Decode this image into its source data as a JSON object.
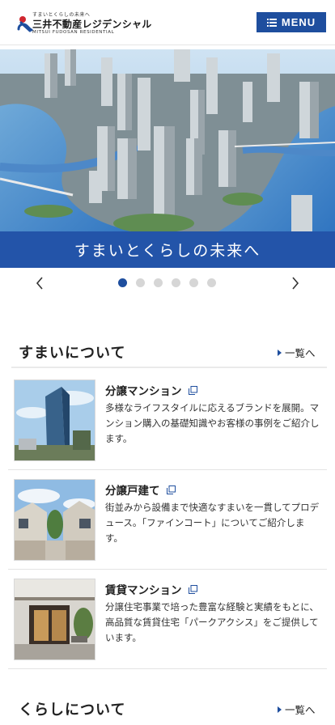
{
  "header": {
    "logo_tagline": "すまいとくらしの未来へ",
    "logo_name": "三井不動産レジデンシャル",
    "logo_en": "MITSUI FUDOSAN RESIDENTIAL",
    "menu_label": "MENU"
  },
  "hero": {
    "caption": "すまいとくらしの未来へ",
    "slide_count": 6,
    "active_slide": 1
  },
  "sections": [
    {
      "title": "すまいについて",
      "link": "一覧へ",
      "items": [
        {
          "title": "分譲マンション",
          "desc": "多様なライフスタイルに応えるブランドを展開。マンション購入の基礎知識やお客様の事例をご紹介します。"
        },
        {
          "title": "分譲戸建て",
          "desc": "街並みから設備まで快適なすまいを一貫してプロデュース。「ファインコート」についてご紹介します。"
        },
        {
          "title": "賃貸マンション",
          "desc": "分譲住宅事業で培った豊富な経験と実績をもとに、高品質な賃貸住宅「パークアクシス」をご提供しています。"
        }
      ]
    },
    {
      "title": "くらしについて",
      "link": "一覧へ"
    }
  ],
  "colors": {
    "brand_blue": "#1e4e9e",
    "caption_blue": "#2354a9",
    "logo_red": "#d0262f"
  }
}
